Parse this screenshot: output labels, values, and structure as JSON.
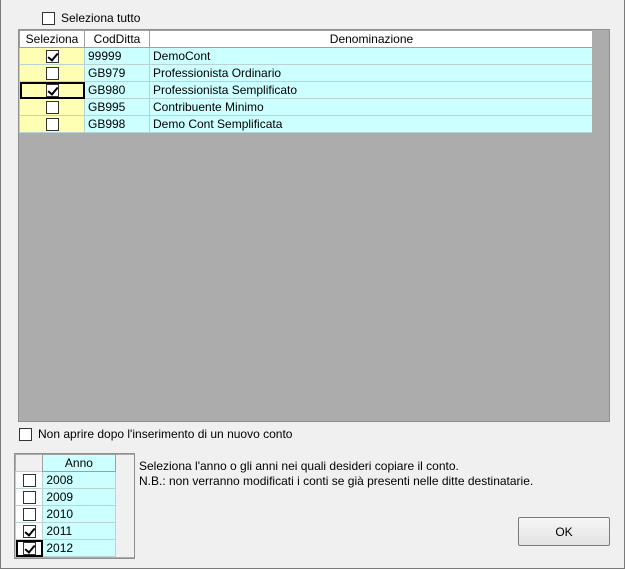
{
  "select_all": {
    "label": "Seleziona tutto",
    "checked": false
  },
  "companies": {
    "columns": [
      "Seleziona",
      "CodDitta",
      "Denominazione"
    ],
    "rows": [
      {
        "checked": true,
        "code": "99999",
        "name": "DemoCont"
      },
      {
        "checked": false,
        "code": "GB979",
        "name": "Professionista Ordinario"
      },
      {
        "checked": true,
        "code": "GB980",
        "name": "Professionista Semplificato"
      },
      {
        "checked": false,
        "code": "GB995",
        "name": "Contribuente Minimo"
      },
      {
        "checked": false,
        "code": "GB998",
        "name": "Demo Cont Semplificata"
      }
    ]
  },
  "no_open": {
    "label": "Non aprire dopo l'inserimento di un nuovo conto",
    "checked": false
  },
  "years": {
    "header": "Anno",
    "rows": [
      {
        "checked": false,
        "year": "2008"
      },
      {
        "checked": false,
        "year": "2009"
      },
      {
        "checked": false,
        "year": "2010"
      },
      {
        "checked": true,
        "year": "2011"
      },
      {
        "checked": true,
        "year": "2012"
      }
    ]
  },
  "info": {
    "line1": "Seleziona l'anno o gli anni nei quali desideri copiare il conto.",
    "line2": "N.B.: non verranno modificati i conti se già presenti nelle ditte destinatarie."
  },
  "ok_label": "OK"
}
